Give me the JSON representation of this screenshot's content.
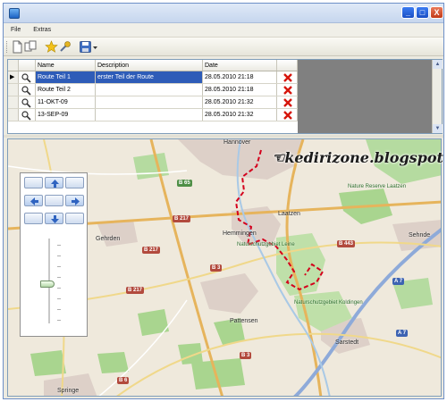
{
  "window": {
    "title": "",
    "buttons": {
      "minimize": "_",
      "maximize": "□",
      "close": "X"
    }
  },
  "menu": {
    "items": [
      "File",
      "Extras"
    ]
  },
  "toolbar": {
    "icons": [
      "new-icon",
      "copy-icon",
      "star-icon",
      "tools-icon",
      "save-icon",
      "dropdown-arrow-icon"
    ]
  },
  "grid": {
    "columns": [
      "",
      "",
      "Name",
      "Description",
      "Date",
      ""
    ],
    "rows": [
      {
        "marker": "▶",
        "icon": "view-icon",
        "name": "Route Teil 1",
        "description": "erster Teil der Route",
        "date": "28.05.2010 21:18",
        "selected": true
      },
      {
        "marker": "",
        "icon": "view-icon",
        "name": "Route Teil 2",
        "description": "",
        "date": "28.05.2010 21:18",
        "selected": false
      },
      {
        "marker": "",
        "icon": "view-icon",
        "name": "11-OKT-09",
        "description": "",
        "date": "28.05.2010 21:32",
        "selected": false
      },
      {
        "marker": "",
        "icon": "view-icon",
        "name": "13-SEP-09",
        "description": "",
        "date": "28.05.2010 21:32",
        "selected": false
      }
    ]
  },
  "map": {
    "watermark": "kedirizone.blogspot.com",
    "places": [
      "Hannover",
      "Gehrden",
      "Hemmingen",
      "Laatzen",
      "Pattensen",
      "Sehnde",
      "Sarstedt",
      "Springe",
      "Nature Reserve Laatzen",
      "Naturschutzgebiet Leine",
      "Naturschutzgebiet Koldingen"
    ],
    "roads": [
      "B 65",
      "B 217",
      "B 217",
      "B 217",
      "B 3",
      "B 3",
      "B 443",
      "A 7",
      "A 7",
      "B 6"
    ]
  },
  "colors": {
    "selection": "#2e5cb8",
    "route": "#d4001c",
    "delete": "#d6150b",
    "titlebar": "#c6d6ee"
  }
}
